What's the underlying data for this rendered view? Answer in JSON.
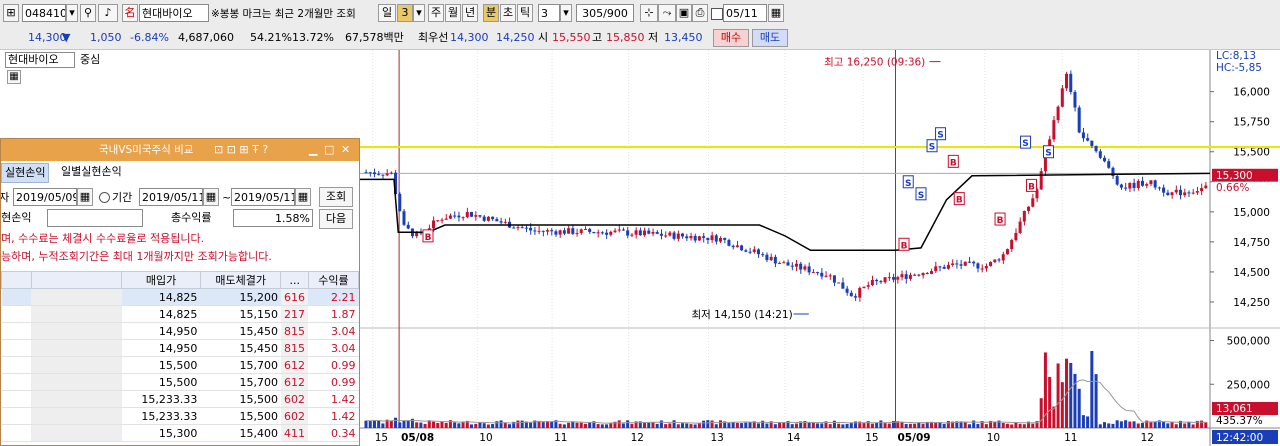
{
  "toolbar": {
    "stock_code": "048410",
    "stock_name": "현대바이오",
    "notice": "※봉봉 마크는 최근 2개월만 조회",
    "periods": [
      "일",
      "3",
      "주",
      "월",
      "년",
      "분",
      "초",
      "틱"
    ],
    "active_period": "분",
    "count": "3",
    "range_display": "305/900",
    "date": "05/11"
  },
  "quote": {
    "price": "14,300",
    "direction": "▼",
    "change": "1,050",
    "change_pct": "-6.84%",
    "volume": "4,687,060",
    "vol_ratio": "54.21%",
    "turnover": "13.72%",
    "amount": "67,578백만",
    "best_label": "최우선",
    "ask": "14,300",
    "bid": "14,250",
    "open_label": "시",
    "open": "15,550",
    "high_label": "고",
    "high": "15,850",
    "low_label": "저",
    "low": "13,450",
    "buy_label": "매수",
    "sell_label": "매도"
  },
  "chart_header": {
    "name": "현대바이오",
    "mode": "중심",
    "lc": "LC:8,13",
    "hc": "HC:-5,85"
  },
  "chart_labels": {
    "max_label": "최고 16,250 (09:36)",
    "min_label": "최저 14,150 (14:21)",
    "price_tag": "15,300",
    "pct_tag": "0.66%",
    "vol_tag": "13,061",
    "vol_pct_tag": "435.37%",
    "time_tag": "12:42:00"
  },
  "chart_data": {
    "type": "candlestick",
    "price_ticks": [
      "16,000",
      "15,750",
      "15,500",
      "15,250",
      "15,000",
      "14,750",
      "14,500",
      "14,250"
    ],
    "volume_ticks": [
      "500,000",
      "250,000"
    ],
    "x_ticks": [
      "15",
      "05/08",
      "10",
      "11",
      "12",
      "13",
      "14",
      "15",
      "05/09",
      "10",
      "11",
      "12"
    ],
    "price_range": [
      14050,
      16330
    ],
    "volume_max": 560000,
    "reference_line": 15540,
    "avg_price_line": 15320,
    "x_tick_frac": [
      0.015,
      0.046,
      0.138,
      0.226,
      0.316,
      0.41,
      0.5,
      0.592,
      0.63,
      0.735,
      0.826,
      0.916
    ],
    "day_separator_frac": [
      0.046,
      0.63
    ]
  },
  "panel": {
    "title": "국내VS미국주식 비교",
    "tabs": [
      "실현손익",
      "일별실현손익"
    ],
    "date_label": "일자",
    "date_value": "2019/05/09",
    "period_label": "기간",
    "period_from": "2019/05/11",
    "period_to": "2019/05/11",
    "query_button": "조회",
    "next_button": "다음",
    "realized_label": "실현손익",
    "total_return_label": "총수익률",
    "total_return": "1.58%",
    "note1": "며, 수수료는 체결시 수수료율로 적용됩니다.",
    "note2": "능하며, 누적조회기간은 최대 1개월까지만 조회가능합니다.",
    "columns": [
      "매입가",
      "매도체결가",
      "...",
      "수익률"
    ],
    "rows": [
      [
        "14,825",
        "15,200",
        "616",
        "2.21"
      ],
      [
        "14,825",
        "15,150",
        "217",
        "1.87"
      ],
      [
        "14,950",
        "15,450",
        "815",
        "3.04"
      ],
      [
        "14,950",
        "15,450",
        "815",
        "3.04"
      ],
      [
        "15,500",
        "15,700",
        "612",
        "0.99"
      ],
      [
        "15,500",
        "15,700",
        "612",
        "0.99"
      ],
      [
        "15,233.33",
        "15,500",
        "602",
        "1.42"
      ],
      [
        "15,233.33",
        "15,500",
        "602",
        "1.42"
      ],
      [
        "15,300",
        "15,400",
        "411",
        "0.34"
      ]
    ]
  },
  "colors": {
    "up": "#c8102e",
    "down": "#1a3db8",
    "reference": "#e8e800",
    "panel_title": "#e8a24a"
  }
}
